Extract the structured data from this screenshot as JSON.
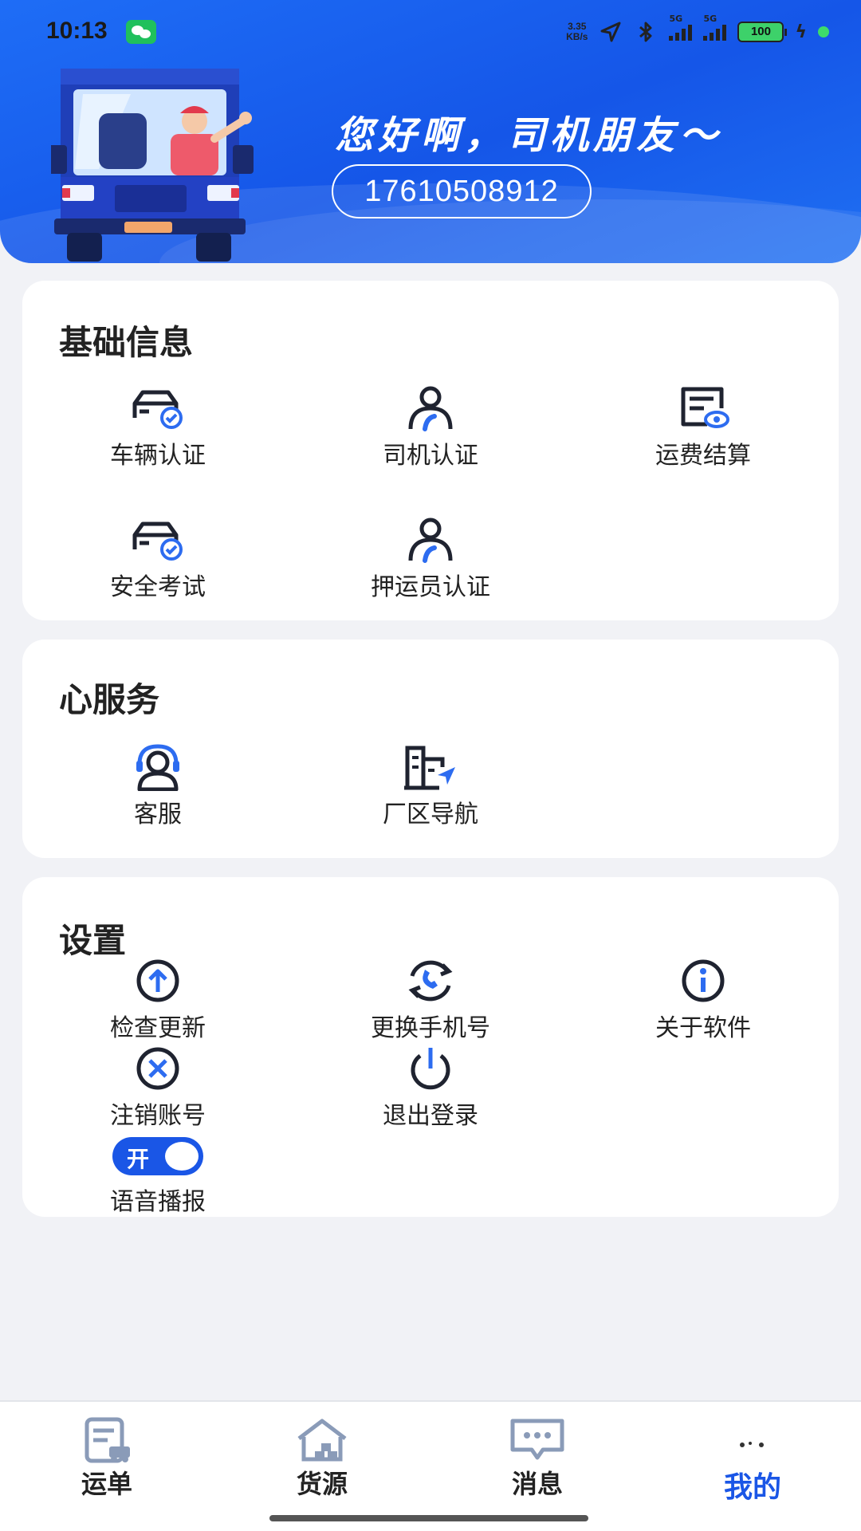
{
  "status_bar": {
    "time": "10:13",
    "speed": "3.35",
    "speed_unit": "KB/s",
    "sim1": "5G",
    "sim2": "5G",
    "battery": "100"
  },
  "header": {
    "greeting": "您好啊，司机朋友～",
    "phone": "17610508912"
  },
  "basic_info": {
    "title": "基础信息",
    "items": [
      {
        "label": "车辆认证",
        "icon": "car-verify-icon"
      },
      {
        "label": "司机认证",
        "icon": "driver-verify-icon"
      },
      {
        "label": "运费结算",
        "icon": "freight-settle-icon"
      },
      {
        "label": "安全考试",
        "icon": "safety-exam-icon"
      },
      {
        "label": "押运员认证",
        "icon": "escort-verify-icon"
      }
    ]
  },
  "service": {
    "title": "心服务",
    "items": [
      {
        "label": "客服",
        "icon": "customer-service-icon"
      },
      {
        "label": "厂区导航",
        "icon": "factory-nav-icon"
      }
    ]
  },
  "settings": {
    "title": "设置",
    "items": [
      {
        "label": "检查更新",
        "icon": "update-icon"
      },
      {
        "label": "更换手机号",
        "icon": "change-phone-icon"
      },
      {
        "label": "关于软件",
        "icon": "info-icon"
      },
      {
        "label": "注销账号",
        "icon": "cancel-account-icon"
      },
      {
        "label": "退出登录",
        "icon": "logout-icon"
      }
    ],
    "voice_toggle": {
      "state_label": "开",
      "label": "语音播报",
      "on": true
    }
  },
  "bottom_nav": [
    {
      "label": "运单",
      "icon": "waybill-icon",
      "active": false
    },
    {
      "label": "货源",
      "icon": "cargo-source-icon",
      "active": false
    },
    {
      "label": "消息",
      "icon": "message-icon",
      "active": false
    },
    {
      "label": "我的",
      "icon": "profile-icon",
      "active": true
    }
  ],
  "colors": {
    "primary": "#1a56e6",
    "header_bg": "#1e6df6",
    "page_bg": "#f1f2f6",
    "icon_accent": "#2d6cf0",
    "icon_dark": "#1f2330",
    "nav_icon": "#8a9bb8"
  }
}
